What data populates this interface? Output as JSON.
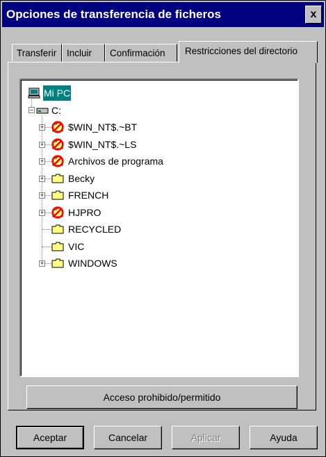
{
  "window": {
    "title": "Opciones de transferencia de ficheros",
    "close_glyph": "x"
  },
  "tabs": [
    {
      "label": "Transferir"
    },
    {
      "label": "Incluir"
    },
    {
      "label": "Confirmación"
    },
    {
      "label": "Restricciones del directorio",
      "active": true
    }
  ],
  "tree": {
    "root": {
      "label": "Mi PC",
      "icon": "computer-icon"
    },
    "drive": {
      "label": "C:",
      "icon": "drive-icon"
    },
    "items": [
      {
        "label": "$WIN_NT$.~BT",
        "icon": "forbidden-folder-icon",
        "expandable": true
      },
      {
        "label": "$WIN_NT$.~LS",
        "icon": "forbidden-folder-icon",
        "expandable": true
      },
      {
        "label": "Archivos de programa",
        "icon": "forbidden-folder-icon",
        "expandable": true
      },
      {
        "label": "Becky",
        "icon": "folder-icon",
        "expandable": true
      },
      {
        "label": "FRENCH",
        "icon": "folder-icon",
        "expandable": true
      },
      {
        "label": "HJPRO",
        "icon": "forbidden-folder-icon",
        "expandable": true
      },
      {
        "label": "RECYCLED",
        "icon": "folder-icon",
        "expandable": false
      },
      {
        "label": "VIC",
        "icon": "folder-icon",
        "expandable": false
      },
      {
        "label": "WINDOWS",
        "icon": "folder-icon",
        "expandable": true
      }
    ]
  },
  "buttons": {
    "access": "Acceso prohibido/permitido",
    "ok": "Aceptar",
    "cancel": "Cancelar",
    "apply": "Aplicar",
    "help": "Ayuda"
  },
  "colors": {
    "titlebar": "#000080",
    "face": "#c0c0c0",
    "selection": "#008080",
    "forbidden": "#ff0000",
    "folder": "#ffff80"
  }
}
